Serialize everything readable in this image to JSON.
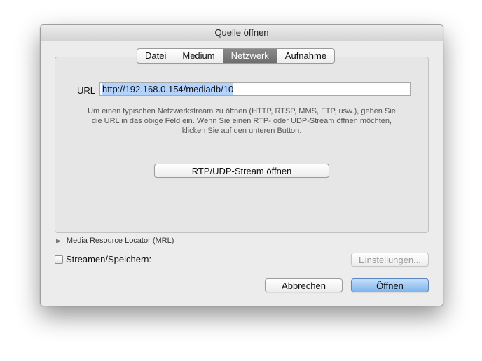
{
  "window": {
    "title": "Quelle öffnen"
  },
  "tabs": [
    {
      "label": "Datei",
      "active": false
    },
    {
      "label": "Medium",
      "active": false
    },
    {
      "label": "Netzwerk",
      "active": true
    },
    {
      "label": "Aufnahme",
      "active": false
    }
  ],
  "url": {
    "label": "URL",
    "value": "http://192.168.0.154/mediadb/10"
  },
  "help": {
    "line1": "Um einen typischen Netzwerkstream zu öffnen (HTTP, RTSP, MMS, FTP, usw.), geben Sie",
    "line2": "die URL in das obige Feld ein. Wenn Sie einen RTP- oder UDP-Stream öffnen möchten,",
    "line3": "klicken Sie auf den unteren Button."
  },
  "buttons": {
    "rtp": "RTP/UDP-Stream öffnen",
    "settings": "Einstellungen...",
    "cancel": "Abbrechen",
    "open": "Öffnen"
  },
  "mrl": {
    "label": "Media Resource Locator (MRL)"
  },
  "stream": {
    "label": "Streamen/Speichern:",
    "checked": false
  },
  "colors": {
    "accent": "#7fb4ec",
    "selection": "#b3d3fd",
    "active_tab": "#7a7a7a"
  }
}
